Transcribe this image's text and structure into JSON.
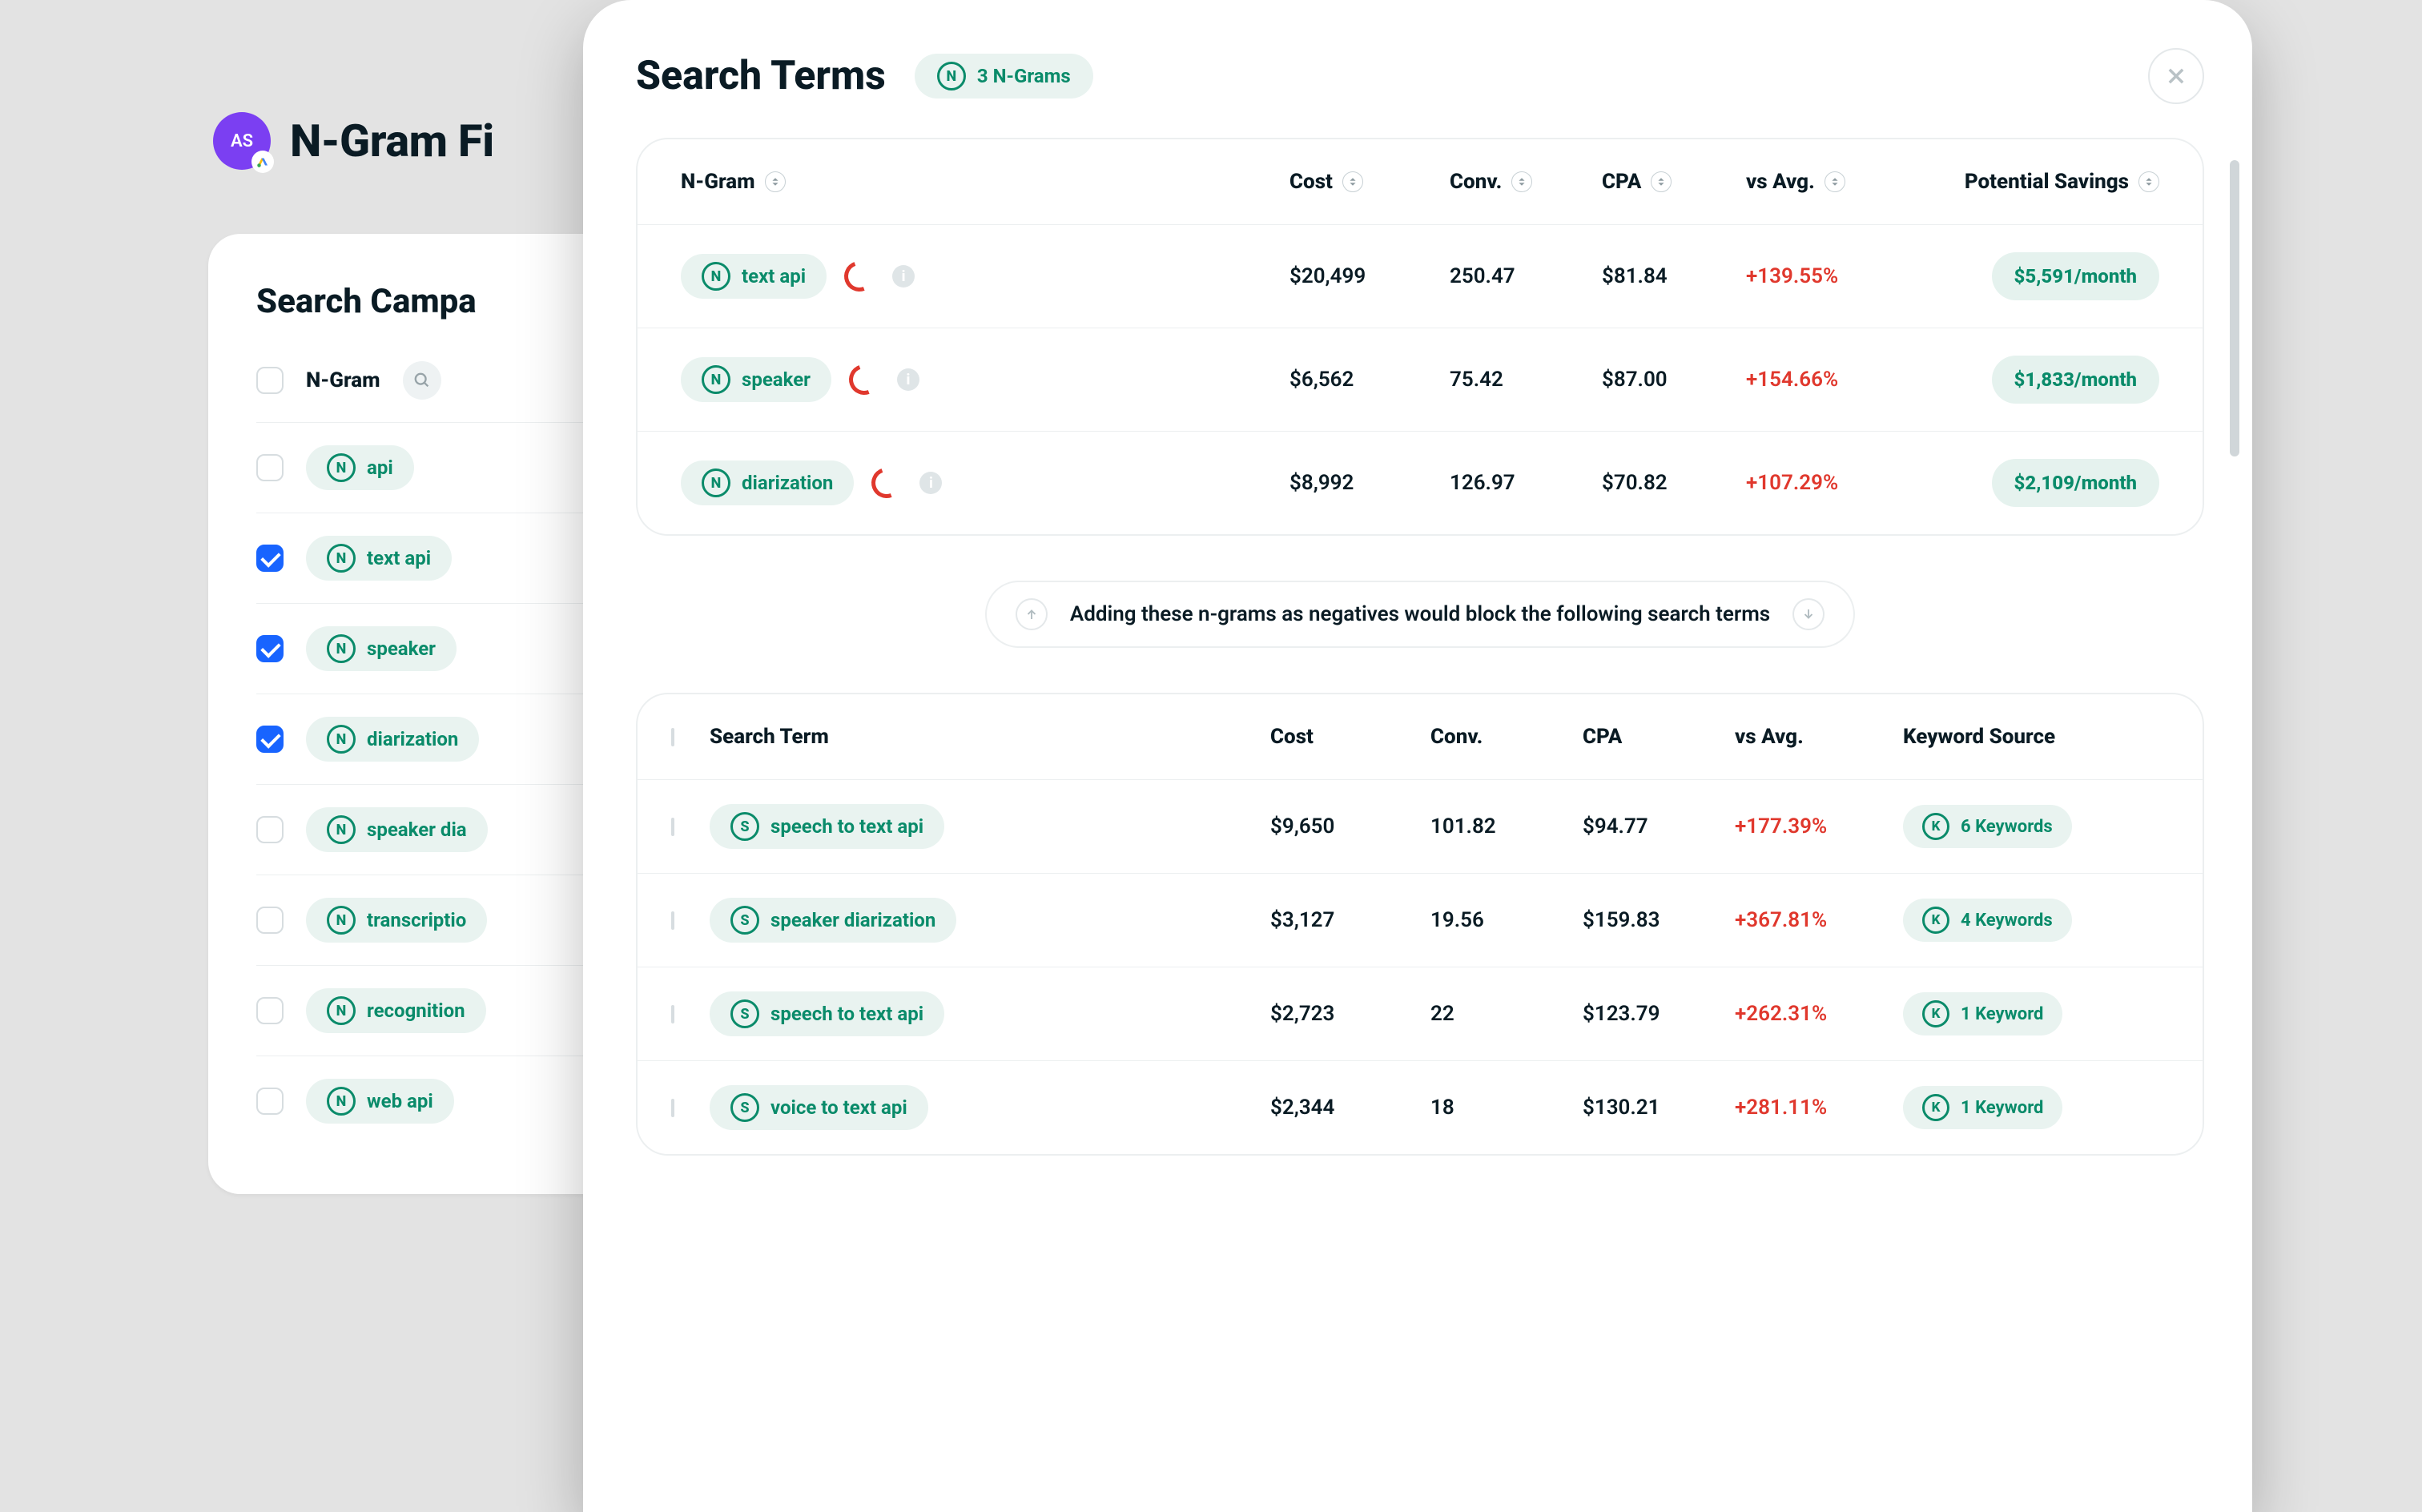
{
  "background": {
    "avatar_initials": "AS",
    "page_title": "N-Gram Fi",
    "panel_title": "Search Campa",
    "header_label": "N-Gram",
    "rows": [
      {
        "label": "api",
        "checked": false
      },
      {
        "label": "text api",
        "checked": true
      },
      {
        "label": "speaker",
        "checked": true
      },
      {
        "label": "diarization",
        "checked": true
      },
      {
        "label": "speaker dia",
        "checked": false
      },
      {
        "label": "transcriptio",
        "checked": false
      },
      {
        "label": "recognition",
        "checked": false
      },
      {
        "label": "web api",
        "checked": false
      }
    ]
  },
  "modal": {
    "title": "Search Terms",
    "count_badge_letter": "N",
    "count_label": "3 N-Grams",
    "banner_text": "Adding these n-grams as negatives would block the following search terms",
    "ngram_table": {
      "headers": {
        "ngram": "N-Gram",
        "cost": "Cost",
        "conv": "Conv.",
        "cpa": "CPA",
        "vs": "vs Avg.",
        "save": "Potential Savings"
      },
      "rows": [
        {
          "label": "text api",
          "cost": "$20,499",
          "conv": "250.47",
          "cpa": "$81.84",
          "vs": "+139.55%",
          "save": "$5,591/month"
        },
        {
          "label": "speaker",
          "cost": "$6,562",
          "conv": "75.42",
          "cpa": "$87.00",
          "vs": "+154.66%",
          "save": "$1,833/month"
        },
        {
          "label": "diarization",
          "cost": "$8,992",
          "conv": "126.97",
          "cpa": "$70.82",
          "vs": "+107.29%",
          "save": "$2,109/month"
        }
      ]
    },
    "search_table": {
      "headers": {
        "term": "Search Term",
        "cost": "Cost",
        "conv": "Conv.",
        "cpa": "CPA",
        "vs": "vs Avg.",
        "src": "Keyword Source"
      },
      "rows": [
        {
          "label": "speech to text api",
          "cost": "$9,650",
          "conv": "101.82",
          "cpa": "$94.77",
          "vs": "+177.39%",
          "kw": "6 Keywords"
        },
        {
          "label": "speaker diarization",
          "cost": "$3,127",
          "conv": "19.56",
          "cpa": "$159.83",
          "vs": "+367.81%",
          "kw": "4 Keywords"
        },
        {
          "label": "speech to text api",
          "cost": "$2,723",
          "conv": "22",
          "cpa": "$123.79",
          "vs": "+262.31%",
          "kw": "1 Keyword"
        },
        {
          "label": "voice to text api",
          "cost": "$2,344",
          "conv": "18",
          "cpa": "$130.21",
          "vs": "+281.11%",
          "kw": "1 Keyword"
        }
      ]
    }
  }
}
